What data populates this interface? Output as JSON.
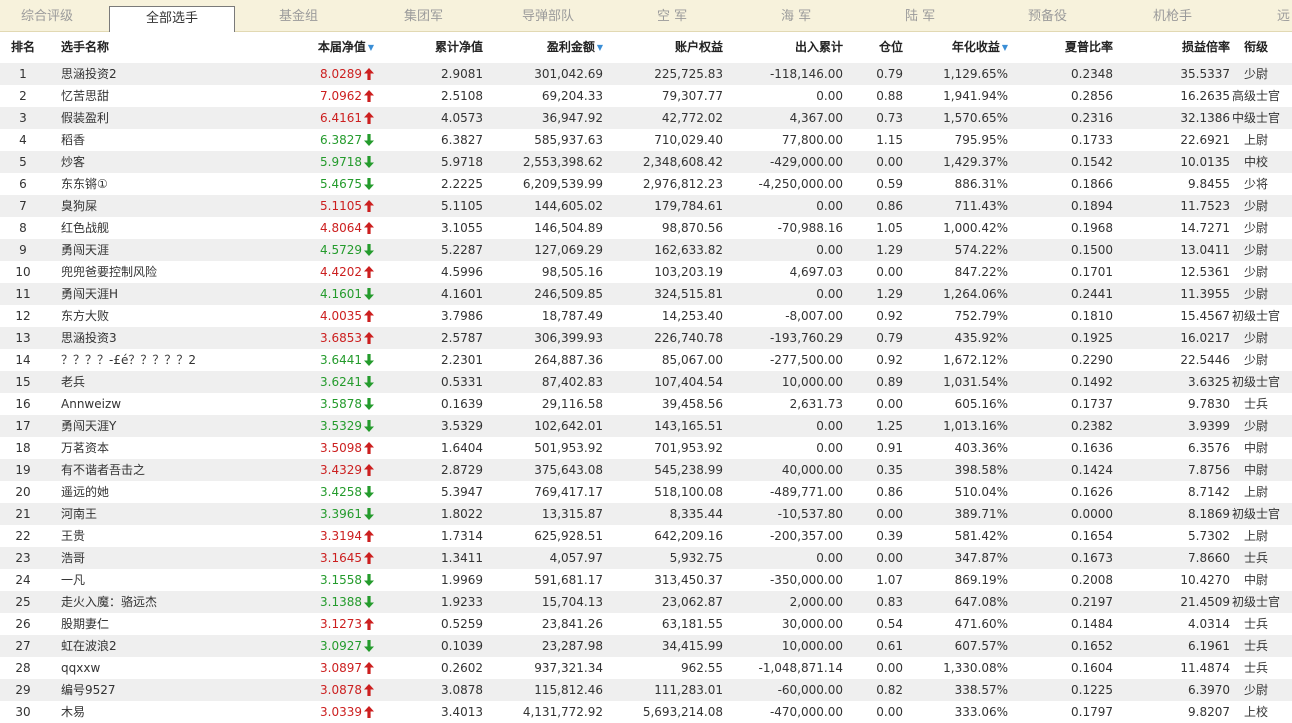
{
  "tabs": [
    "综合评级",
    "全部选手",
    "基金组",
    "集团军",
    "导弹部队",
    "空 军",
    "海 军",
    "陆 军",
    "预备役",
    "机枪手",
    "远"
  ],
  "active_tab": 1,
  "headers": {
    "rank": "排名",
    "name": "选手名称",
    "nav": "本届净值",
    "cum": "累计净值",
    "profit": "盈利金额",
    "equity": "账户权益",
    "inout": "出入累计",
    "pos": "仓位",
    "annual": "年化收益",
    "sharpe": "夏普比率",
    "plr": "损益倍率",
    "level": "衔级"
  },
  "sorted_columns": [
    "nav",
    "profit",
    "annual"
  ],
  "colors": {
    "up": "#cc1f1f",
    "down": "#249b2c",
    "sort": "#3a8ed6"
  },
  "rows": [
    {
      "rank": "1",
      "name": "思涵投资2",
      "nav": "8.0289",
      "trend": "up",
      "cum": "2.9081",
      "profit": "301,042.69",
      "equity": "225,725.83",
      "inout": "-118,146.00",
      "pos": "0.79",
      "annual": "1,129.65%",
      "sharpe": "0.2348",
      "plr": "35.5337",
      "level": "少尉"
    },
    {
      "rank": "2",
      "name": "忆苦思甜",
      "nav": "7.0962",
      "trend": "up",
      "cum": "2.5108",
      "profit": "69,204.33",
      "equity": "79,307.77",
      "inout": "0.00",
      "pos": "0.88",
      "annual": "1,941.94%",
      "sharpe": "0.2856",
      "plr": "16.2635",
      "level": "高级士官"
    },
    {
      "rank": "3",
      "name": "假装盈利",
      "nav": "6.4161",
      "trend": "up",
      "cum": "4.0573",
      "profit": "36,947.92",
      "equity": "42,772.02",
      "inout": "4,367.00",
      "pos": "0.73",
      "annual": "1,570.65%",
      "sharpe": "0.2316",
      "plr": "32.1386",
      "level": "中级士官"
    },
    {
      "rank": "4",
      "name": "稻香",
      "nav": "6.3827",
      "trend": "down",
      "cum": "6.3827",
      "profit": "585,937.63",
      "equity": "710,029.40",
      "inout": "77,800.00",
      "pos": "1.15",
      "annual": "795.95%",
      "sharpe": "0.1733",
      "plr": "22.6921",
      "level": "上尉"
    },
    {
      "rank": "5",
      "name": "炒客",
      "nav": "5.9718",
      "trend": "down",
      "cum": "5.9718",
      "profit": "2,553,398.62",
      "equity": "2,348,608.42",
      "inout": "-429,000.00",
      "pos": "0.00",
      "annual": "1,429.37%",
      "sharpe": "0.1542",
      "plr": "10.0135",
      "level": "中校"
    },
    {
      "rank": "6",
      "name": "东东锵①",
      "nav": "5.4675",
      "trend": "down",
      "cum": "2.2225",
      "profit": "6,209,539.99",
      "equity": "2,976,812.23",
      "inout": "-4,250,000.00",
      "pos": "0.59",
      "annual": "886.31%",
      "sharpe": "0.1866",
      "plr": "9.8455",
      "level": "少将"
    },
    {
      "rank": "7",
      "name": "臭狗屎",
      "nav": "5.1105",
      "trend": "up",
      "cum": "5.1105",
      "profit": "144,605.02",
      "equity": "179,784.61",
      "inout": "0.00",
      "pos": "0.86",
      "annual": "711.43%",
      "sharpe": "0.1894",
      "plr": "11.7523",
      "level": "少尉"
    },
    {
      "rank": "8",
      "name": "红色战舰",
      "nav": "4.8064",
      "trend": "up",
      "cum": "3.1055",
      "profit": "146,504.89",
      "equity": "98,870.56",
      "inout": "-70,988.16",
      "pos": "1.05",
      "annual": "1,000.42%",
      "sharpe": "0.1968",
      "plr": "14.7271",
      "level": "少尉"
    },
    {
      "rank": "9",
      "name": "勇闯天涯",
      "nav": "4.5729",
      "trend": "down",
      "cum": "5.2287",
      "profit": "127,069.29",
      "equity": "162,633.82",
      "inout": "0.00",
      "pos": "1.29",
      "annual": "574.22%",
      "sharpe": "0.1500",
      "plr": "13.0411",
      "level": "少尉"
    },
    {
      "rank": "10",
      "name": "兜兜爸要控制风险",
      "nav": "4.4202",
      "trend": "up",
      "cum": "4.5996",
      "profit": "98,505.16",
      "equity": "103,203.19",
      "inout": "4,697.03",
      "pos": "0.00",
      "annual": "847.22%",
      "sharpe": "0.1701",
      "plr": "12.5361",
      "level": "少尉"
    },
    {
      "rank": "11",
      "name": "勇闯天涯H",
      "nav": "4.1601",
      "trend": "down",
      "cum": "4.1601",
      "profit": "246,509.85",
      "equity": "324,515.81",
      "inout": "0.00",
      "pos": "1.29",
      "annual": "1,264.06%",
      "sharpe": "0.2441",
      "plr": "11.3955",
      "level": "少尉"
    },
    {
      "rank": "12",
      "name": "东方大败",
      "nav": "4.0035",
      "trend": "up",
      "cum": "3.7986",
      "profit": "18,787.49",
      "equity": "14,253.40",
      "inout": "-8,007.00",
      "pos": "0.92",
      "annual": "752.79%",
      "sharpe": "0.1810",
      "plr": "15.4567",
      "level": "初级士官"
    },
    {
      "rank": "13",
      "name": "思涵投资3",
      "nav": "3.6853",
      "trend": "up",
      "cum": "2.5787",
      "profit": "306,399.93",
      "equity": "226,740.78",
      "inout": "-193,760.29",
      "pos": "0.79",
      "annual": "435.92%",
      "sharpe": "0.1925",
      "plr": "16.0217",
      "level": "少尉"
    },
    {
      "rank": "14",
      "name": "？？？？-£é？？？？？2",
      "nav": "3.6441",
      "trend": "down",
      "cum": "2.2301",
      "profit": "264,887.36",
      "equity": "85,067.00",
      "inout": "-277,500.00",
      "pos": "0.92",
      "annual": "1,672.12%",
      "sharpe": "0.2290",
      "plr": "22.5446",
      "level": "少尉"
    },
    {
      "rank": "15",
      "name": "老兵",
      "nav": "3.6241",
      "trend": "down",
      "cum": "0.5331",
      "profit": "87,402.83",
      "equity": "107,404.54",
      "inout": "10,000.00",
      "pos": "0.89",
      "annual": "1,031.54%",
      "sharpe": "0.1492",
      "plr": "3.6325",
      "level": "初级士官"
    },
    {
      "rank": "16",
      "name": "Annweizw",
      "nav": "3.5878",
      "trend": "down",
      "cum": "0.1639",
      "profit": "29,116.58",
      "equity": "39,458.56",
      "inout": "2,631.73",
      "pos": "0.00",
      "annual": "605.16%",
      "sharpe": "0.1737",
      "plr": "9.7830",
      "level": "士兵"
    },
    {
      "rank": "17",
      "name": "勇闯天涯Y",
      "nav": "3.5329",
      "trend": "down",
      "cum": "3.5329",
      "profit": "102,642.01",
      "equity": "143,165.51",
      "inout": "0.00",
      "pos": "1.25",
      "annual": "1,013.16%",
      "sharpe": "0.2382",
      "plr": "3.9399",
      "level": "少尉"
    },
    {
      "rank": "18",
      "name": "万茗资本",
      "nav": "3.5098",
      "trend": "up",
      "cum": "1.6404",
      "profit": "501,953.92",
      "equity": "701,953.92",
      "inout": "0.00",
      "pos": "0.91",
      "annual": "403.36%",
      "sharpe": "0.1636",
      "plr": "6.3576",
      "level": "中尉"
    },
    {
      "rank": "19",
      "name": "有不谐者吾击之",
      "nav": "3.4329",
      "trend": "up",
      "cum": "2.8729",
      "profit": "375,643.08",
      "equity": "545,238.99",
      "inout": "40,000.00",
      "pos": "0.35",
      "annual": "398.58%",
      "sharpe": "0.1424",
      "plr": "7.8756",
      "level": "中尉"
    },
    {
      "rank": "20",
      "name": "遥远的她",
      "nav": "3.4258",
      "trend": "down",
      "cum": "5.3947",
      "profit": "769,417.17",
      "equity": "518,100.08",
      "inout": "-489,771.00",
      "pos": "0.86",
      "annual": "510.04%",
      "sharpe": "0.1626",
      "plr": "8.7142",
      "level": "上尉"
    },
    {
      "rank": "21",
      "name": "河南王",
      "nav": "3.3961",
      "trend": "down",
      "cum": "1.8022",
      "profit": "13,315.87",
      "equity": "8,335.44",
      "inout": "-10,537.80",
      "pos": "0.00",
      "annual": "389.71%",
      "sharpe": "0.0000",
      "plr": "8.1869",
      "level": "初级士官"
    },
    {
      "rank": "22",
      "name": "王贵",
      "nav": "3.3194",
      "trend": "up",
      "cum": "1.7314",
      "profit": "625,928.51",
      "equity": "642,209.16",
      "inout": "-200,357.00",
      "pos": "0.39",
      "annual": "581.42%",
      "sharpe": "0.1654",
      "plr": "5.7302",
      "level": "上尉"
    },
    {
      "rank": "23",
      "name": "浩哥",
      "nav": "3.1645",
      "trend": "up",
      "cum": "1.3411",
      "profit": "4,057.97",
      "equity": "5,932.75",
      "inout": "0.00",
      "pos": "0.00",
      "annual": "347.87%",
      "sharpe": "0.1673",
      "plr": "7.8660",
      "level": "士兵"
    },
    {
      "rank": "24",
      "name": "一凡",
      "nav": "3.1558",
      "trend": "down",
      "cum": "1.9969",
      "profit": "591,681.17",
      "equity": "313,450.37",
      "inout": "-350,000.00",
      "pos": "1.07",
      "annual": "869.19%",
      "sharpe": "0.2008",
      "plr": "10.4270",
      "level": "中尉"
    },
    {
      "rank": "25",
      "name": "走火入魔：骆远杰",
      "nav": "3.1388",
      "trend": "down",
      "cum": "1.9233",
      "profit": "15,704.13",
      "equity": "23,062.87",
      "inout": "2,000.00",
      "pos": "0.83",
      "annual": "647.08%",
      "sharpe": "0.2197",
      "plr": "21.4509",
      "level": "初级士官"
    },
    {
      "rank": "26",
      "name": "股期妻仁",
      "nav": "3.1273",
      "trend": "up",
      "cum": "0.5259",
      "profit": "23,841.26",
      "equity": "63,181.55",
      "inout": "30,000.00",
      "pos": "0.54",
      "annual": "471.60%",
      "sharpe": "0.1484",
      "plr": "4.0314",
      "level": "士兵"
    },
    {
      "rank": "27",
      "name": "虹在波浪2",
      "nav": "3.0927",
      "trend": "down",
      "cum": "0.1039",
      "profit": "23,287.98",
      "equity": "34,415.99",
      "inout": "10,000.00",
      "pos": "0.61",
      "annual": "607.57%",
      "sharpe": "0.1652",
      "plr": "6.1961",
      "level": "士兵"
    },
    {
      "rank": "28",
      "name": "qqxxw",
      "nav": "3.0897",
      "trend": "up",
      "cum": "0.2602",
      "profit": "937,321.34",
      "equity": "962.55",
      "inout": "-1,048,871.14",
      "pos": "0.00",
      "annual": "1,330.08%",
      "sharpe": "0.1604",
      "plr": "11.4874",
      "level": "士兵"
    },
    {
      "rank": "29",
      "name": "编号9527",
      "nav": "3.0878",
      "trend": "up",
      "cum": "3.0878",
      "profit": "115,812.46",
      "equity": "111,283.01",
      "inout": "-60,000.00",
      "pos": "0.82",
      "annual": "338.57%",
      "sharpe": "0.1225",
      "plr": "6.3970",
      "level": "少尉"
    },
    {
      "rank": "30",
      "name": "木易",
      "nav": "3.0339",
      "trend": "up",
      "cum": "3.4013",
      "profit": "4,131,772.92",
      "equity": "5,693,214.08",
      "inout": "-470,000.00",
      "pos": "0.00",
      "annual": "333.06%",
      "sharpe": "0.1797",
      "plr": "9.8207",
      "level": "上校"
    }
  ]
}
